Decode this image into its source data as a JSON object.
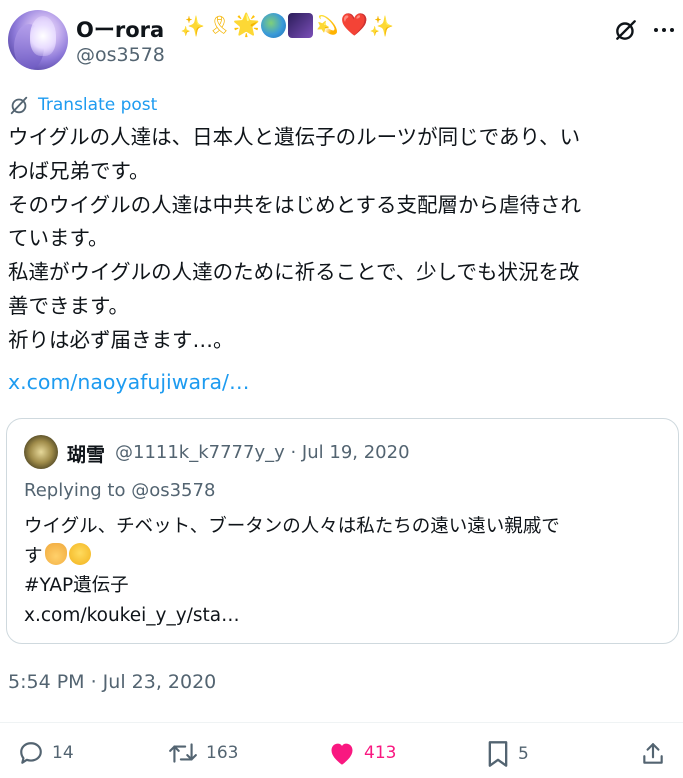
{
  "author": {
    "display_name": "Oーrora",
    "emojis": [
      "✨",
      "🎗",
      "🌟",
      "🌏",
      "🌌",
      "💫",
      "❤️",
      "✨"
    ],
    "handle": "@os3578"
  },
  "icons": {
    "grok": "grok-icon",
    "more": "more-icon",
    "translate": "globe-slash-icon",
    "reply": "reply-icon",
    "retweet": "retweet-icon",
    "like": "heart-icon",
    "bookmark": "bookmark-icon",
    "share": "share-icon"
  },
  "translate_label": "Translate post",
  "post": {
    "lines": [
      "ウイグルの人達は、日本人と遺伝子のルーツが同じであり、い",
      "わば兄弟です。",
      "そのウイグルの人達は中共をはじめとする支配層から虐待され",
      "ています。",
      "私達がウイグルの人達のために祈ることで、少しでも状況を改",
      "善できます。",
      "祈りは必ず届きます…。"
    ],
    "link": "x.com/naoyafujiwara/…"
  },
  "quote": {
    "name": "瑚雪",
    "meta": "@1111k_k7777y_y · Jul 19, 2020",
    "replying_to": "Replying to @os3578",
    "line1": "ウイグル、チベット、ブータンの人々は私たちの遠い遠い親戚で",
    "line2": "す",
    "line2_emojis": [
      "🙏",
      "😥"
    ],
    "hashtag": "#YAP遺伝子",
    "link": "x.com/koukei_y_y/sta…"
  },
  "timestamp": "5:54 PM · Jul 23, 2020",
  "actions": {
    "replies": "14",
    "retweets": "163",
    "likes": "413",
    "bookmarks": "5"
  },
  "colors": {
    "accent": "#1d9bf0",
    "like": "#f91880",
    "text": "#0f1419",
    "muted": "#536471",
    "border": "#cfd9de"
  }
}
